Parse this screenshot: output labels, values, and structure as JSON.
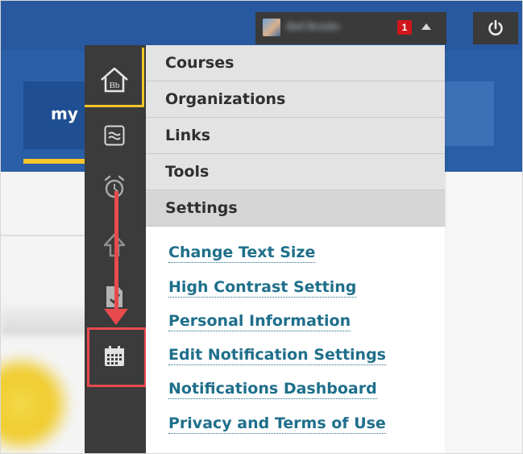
{
  "header": {
    "user_name": "Bell Brooks",
    "notification_count": "1",
    "accent_color": "#2a5ea6"
  },
  "background": {
    "tab_label": "my"
  },
  "menu": {
    "tabs": [
      {
        "label": "Courses"
      },
      {
        "label": "Organizations"
      },
      {
        "label": "Links"
      },
      {
        "label": "Tools"
      },
      {
        "label": "Settings",
        "active": true
      }
    ],
    "settings_links": [
      {
        "label": "Change Text Size"
      },
      {
        "label": "High Contrast Setting"
      },
      {
        "label": "Personal Information"
      },
      {
        "label": "Edit Notification Settings"
      },
      {
        "label": "Notifications Dashboard"
      },
      {
        "label": "Privacy and Terms of Use"
      }
    ],
    "link_color": "#1f6f8b"
  },
  "icon_strip": {
    "icons": [
      "home-bb-icon",
      "waves-icon",
      "alarm-clock-icon",
      "upload-icon",
      "document-icon",
      "calendar-icon"
    ]
  },
  "annotation": {
    "color": "#e84a4e"
  }
}
